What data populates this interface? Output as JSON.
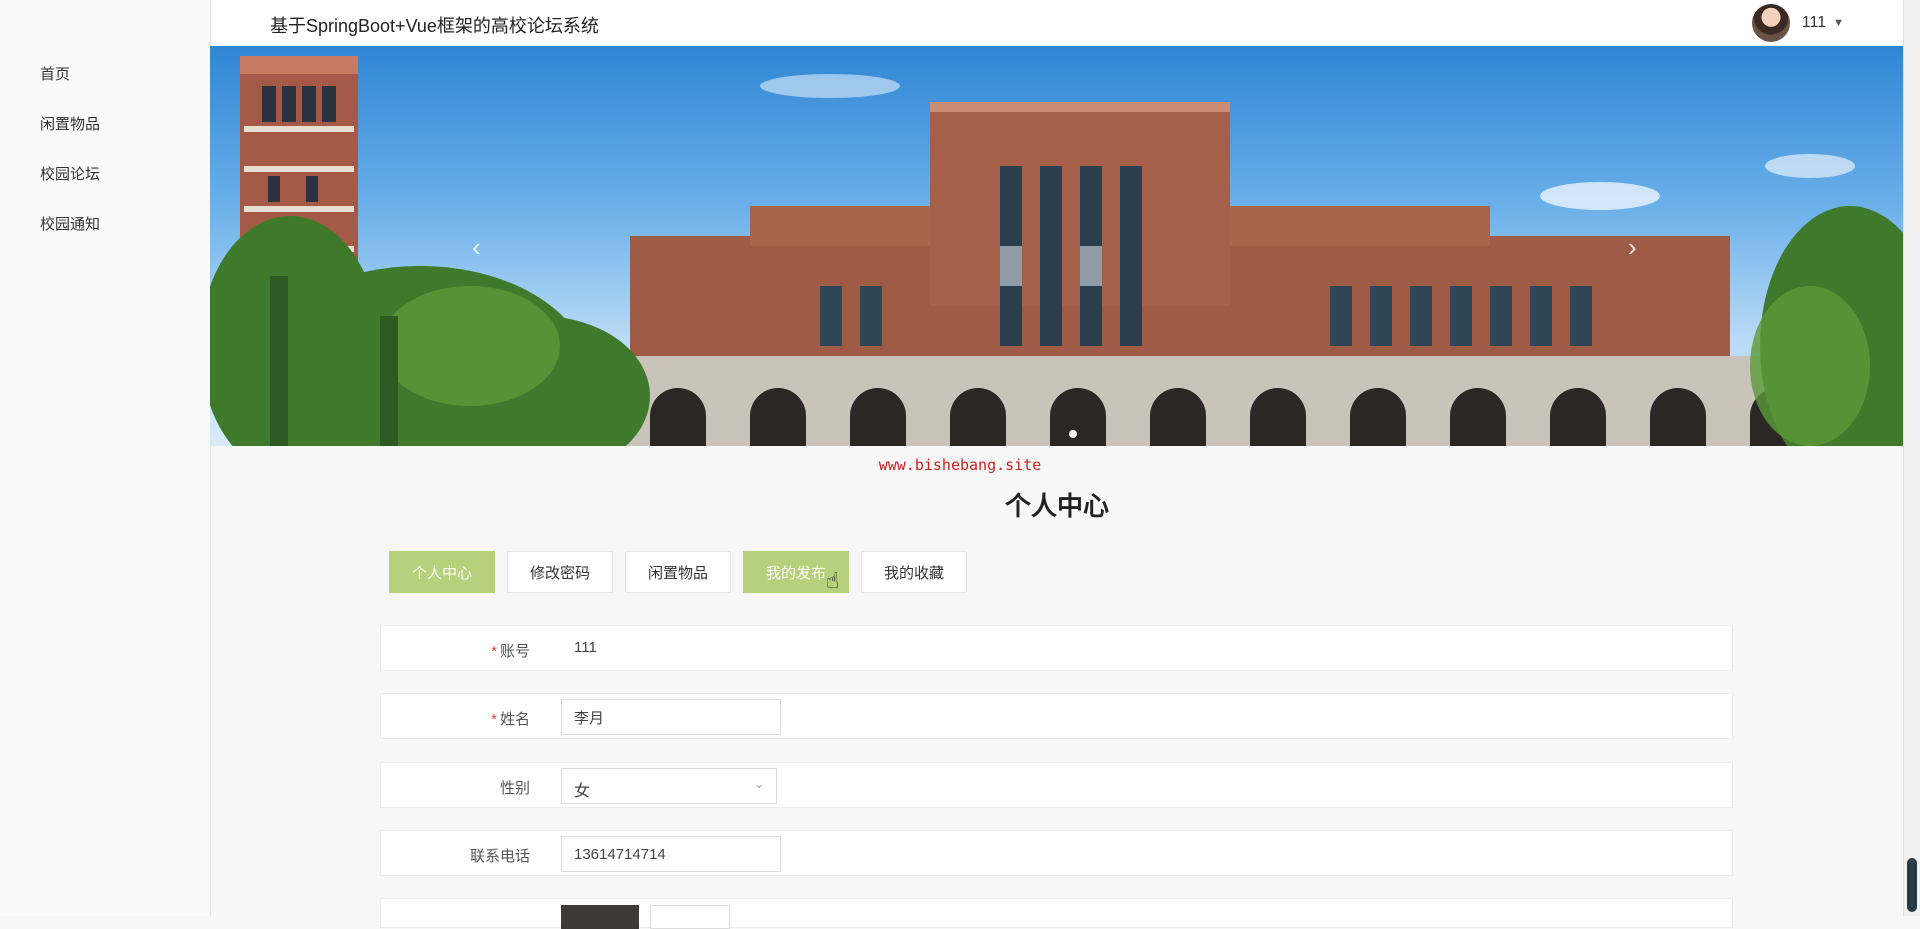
{
  "app": {
    "title": "基于SpringBoot+Vue框架的高校论坛系统"
  },
  "sidebar": {
    "items": [
      {
        "label": "首页"
      },
      {
        "label": "闲置物品"
      },
      {
        "label": "校园论坛"
      },
      {
        "label": "校园通知"
      }
    ]
  },
  "header": {
    "username": "111",
    "caret": "▼"
  },
  "banner": {
    "prev": "‹",
    "next": "›"
  },
  "watermark": "www.bishebang.site",
  "page": {
    "title": "个人中心"
  },
  "tabs": [
    {
      "label": "个人中心",
      "active": true
    },
    {
      "label": "修改密码",
      "active": false
    },
    {
      "label": "闲置物品",
      "active": false
    },
    {
      "label": "我的发布",
      "active": true
    },
    {
      "label": "我的收藏",
      "active": false
    }
  ],
  "form": {
    "account": {
      "label": "账号",
      "value": "111",
      "required": "*"
    },
    "name": {
      "label": "姓名",
      "value": "李月",
      "required": "*"
    },
    "gender": {
      "label": "性别",
      "value": "女"
    },
    "phone": {
      "label": "联系电话",
      "value": "13614714714"
    }
  },
  "colors": {
    "accent": "#b6d07b",
    "required": "#e54444",
    "watermark": "#cc2222"
  }
}
